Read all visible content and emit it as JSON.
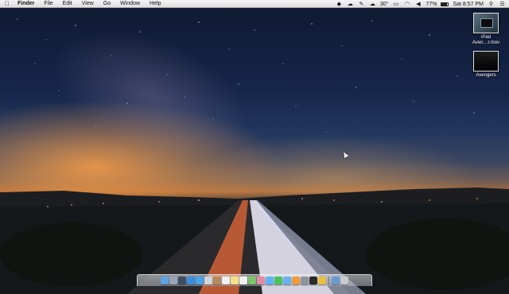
{
  "menubar": {
    "apple_icon": "apple-icon",
    "app_name": "Finder",
    "menus": [
      "File",
      "Edit",
      "View",
      "Go",
      "Window",
      "Help"
    ]
  },
  "status": {
    "icons": [
      "dropbox-icon",
      "cloud-sync-icon",
      "evernote-icon",
      "weather-icon"
    ],
    "temperature": "30°",
    "more_icons": [
      "airplay-icon",
      "wifi-icon",
      "volume-icon"
    ],
    "battery_percent": "77%",
    "battery_level": 0.77,
    "clock": "Sat 8:57 PM",
    "search_icon": "spotlight-search-icon",
    "menu_icon": "notification-center-icon"
  },
  "desktop": {
    "items": [
      {
        "label_line1": "iPad",
        "label_line2": "Aven…r.mov",
        "icon": "video-file-icon"
      },
      {
        "label_line1": "Avengers",
        "label_line2": "",
        "icon": "video-file-icon"
      }
    ]
  },
  "dock": {
    "apps": [
      {
        "name": "finder-icon",
        "color": "#5fa3e6"
      },
      {
        "name": "launchpad-icon",
        "color": "#9aa6b3"
      },
      {
        "name": "mission-control-icon",
        "color": "#3f4d63"
      },
      {
        "name": "app-store-icon",
        "color": "#3b8de0"
      },
      {
        "name": "safari-icon",
        "color": "#4aa4e8"
      },
      {
        "name": "mail-icon",
        "color": "#cfd6de"
      },
      {
        "name": "contacts-icon",
        "color": "#b48b5a"
      },
      {
        "name": "calendar-icon",
        "color": "#f2f2f2"
      },
      {
        "name": "notes-icon",
        "color": "#f4e28a"
      },
      {
        "name": "reminders-icon",
        "color": "#f0f0f0"
      },
      {
        "name": "maps-icon",
        "color": "#7cc46a"
      },
      {
        "name": "photos-icon",
        "color": "#e58aa4"
      },
      {
        "name": "messages-icon",
        "color": "#5fb3f0"
      },
      {
        "name": "facetime-icon",
        "color": "#4cc25a"
      },
      {
        "name": "itunes-icon",
        "color": "#6ab0f2"
      },
      {
        "name": "ibooks-icon",
        "color": "#f29a3b"
      },
      {
        "name": "system-preferences-icon",
        "color": "#8f959c"
      },
      {
        "name": "terminal-icon",
        "color": "#2b2b2b"
      },
      {
        "name": "chrome-icon",
        "color": "#e8c240"
      }
    ],
    "trailing": [
      {
        "name": "downloads-stack-icon",
        "color": "#6b9ad0"
      },
      {
        "name": "trash-icon",
        "color": "#c7cbd0"
      }
    ]
  }
}
